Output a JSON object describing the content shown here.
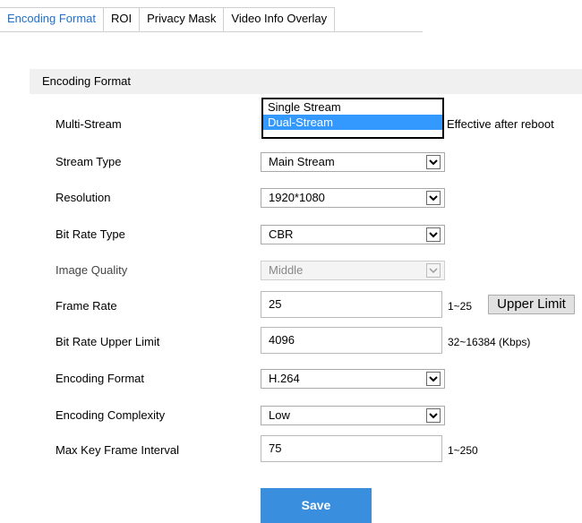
{
  "tabs": [
    {
      "label": "Encoding Format",
      "active": true
    },
    {
      "label": "ROI",
      "active": false
    },
    {
      "label": "Privacy Mask",
      "active": false
    },
    {
      "label": "Video Info Overlay",
      "active": false
    }
  ],
  "section": {
    "title": "Encoding Format"
  },
  "fields": {
    "multi_stream": {
      "label": "Multi-Stream",
      "options": [
        "Single Stream",
        "Dual-Stream"
      ],
      "selected": "Dual-Stream",
      "hint": "Effective after reboot"
    },
    "stream_type": {
      "label": "Stream Type",
      "value": "Main Stream"
    },
    "resolution": {
      "label": "Resolution",
      "value": "1920*1080"
    },
    "bit_rate_type": {
      "label": "Bit Rate Type",
      "value": "CBR"
    },
    "image_quality": {
      "label": "Image Quality",
      "value": "Middle",
      "disabled": true
    },
    "frame_rate": {
      "label": "Frame Rate",
      "value": "25",
      "hint": "1~25",
      "button": "Upper Limit"
    },
    "bit_rate_upper_limit": {
      "label": "Bit Rate Upper Limit",
      "value": "4096",
      "hint": "32~16384 (Kbps)"
    },
    "encoding_format": {
      "label": "Encoding Format",
      "value": "H.264"
    },
    "encoding_complexity": {
      "label": "Encoding Complexity",
      "value": "Low"
    },
    "max_key_frame_interval": {
      "label": "Max Key Frame Interval",
      "value": "75",
      "hint": "1~250"
    }
  },
  "actions": {
    "save_label": "Save"
  },
  "colors": {
    "accent": "#1e6fc9",
    "save_bg": "#3a8ede",
    "selection": "#3399ff",
    "header_bg": "#f0f0f0"
  }
}
